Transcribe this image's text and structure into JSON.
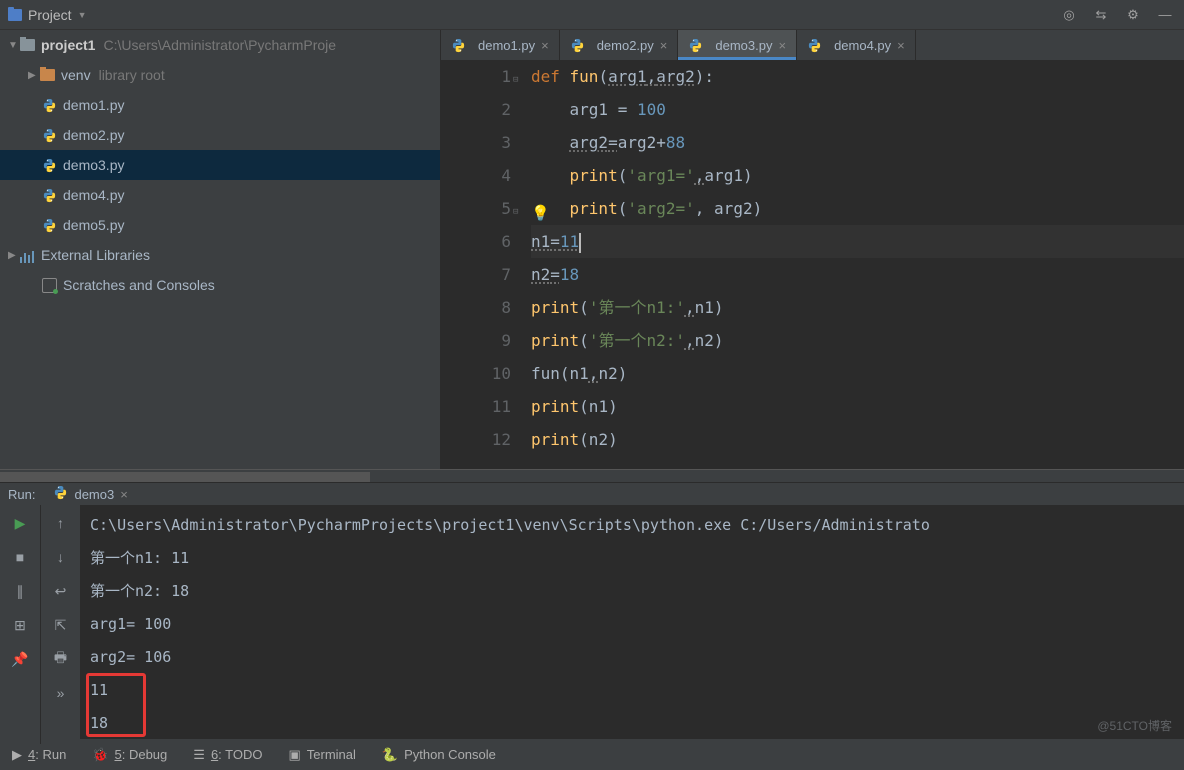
{
  "toolbar": {
    "project_label": "Project"
  },
  "tree": {
    "root_name": "project1",
    "root_path": "C:\\Users\\Administrator\\PycharmProje",
    "venv": "venv",
    "venv_note": "library root",
    "files": [
      "demo1.py",
      "demo2.py",
      "demo3.py",
      "demo4.py",
      "demo5.py"
    ],
    "ext_lib": "External Libraries",
    "scratches": "Scratches and Consoles"
  },
  "tabs": [
    {
      "label": "demo1.py"
    },
    {
      "label": "demo2.py"
    },
    {
      "label": "demo3.py"
    },
    {
      "label": "demo4.py"
    }
  ],
  "active_tab": 2,
  "selected_file": 2,
  "code": {
    "lines": [
      {
        "n": 1,
        "seg": [
          {
            "t": "def ",
            "c": "kw"
          },
          {
            "t": "fun",
            "c": "fn"
          },
          {
            "t": "(",
            "c": ""
          },
          {
            "t": "arg1",
            "c": "par und"
          },
          {
            "t": ",",
            "c": "und"
          },
          {
            "t": "arg2",
            "c": "par und"
          },
          {
            "t": ")",
            "c": ""
          },
          {
            "t": ":",
            "c": ""
          }
        ],
        "ind": 0
      },
      {
        "n": 2,
        "seg": [
          {
            "t": "arg1 = ",
            "c": ""
          },
          {
            "t": "100",
            "c": "num"
          }
        ],
        "ind": 1
      },
      {
        "n": 3,
        "seg": [
          {
            "t": "arg2",
            "c": "und"
          },
          {
            "t": "=",
            "c": "und"
          },
          {
            "t": "arg2+",
            "c": ""
          },
          {
            "t": "88",
            "c": "num"
          }
        ],
        "ind": 1
      },
      {
        "n": 4,
        "seg": [
          {
            "t": "print",
            "c": "fn"
          },
          {
            "t": "(",
            "c": ""
          },
          {
            "t": "'arg1='",
            "c": "str"
          },
          {
            "t": ",",
            "c": "und"
          },
          {
            "t": "arg1)",
            "c": ""
          }
        ],
        "ind": 1
      },
      {
        "n": 5,
        "seg": [
          {
            "t": "print",
            "c": "fn"
          },
          {
            "t": "(",
            "c": ""
          },
          {
            "t": "'arg2='",
            "c": "str"
          },
          {
            "t": ", arg2)",
            "c": ""
          }
        ],
        "ind": 1
      },
      {
        "n": 6,
        "seg": [
          {
            "t": "n1",
            "c": "und"
          },
          {
            "t": "=",
            "c": "und"
          },
          {
            "t": "11",
            "c": "num und"
          }
        ],
        "ind": 0,
        "hl": true,
        "cursor": true
      },
      {
        "n": 7,
        "seg": [
          {
            "t": "n2",
            "c": "und"
          },
          {
            "t": "=",
            "c": "und"
          },
          {
            "t": "18",
            "c": "num"
          }
        ],
        "ind": 0
      },
      {
        "n": 8,
        "seg": [
          {
            "t": "print",
            "c": "fn"
          },
          {
            "t": "(",
            "c": ""
          },
          {
            "t": "'第一个n1:'",
            "c": "str"
          },
          {
            "t": ",",
            "c": "und"
          },
          {
            "t": "n1)",
            "c": ""
          }
        ],
        "ind": 0
      },
      {
        "n": 9,
        "seg": [
          {
            "t": "print",
            "c": "fn"
          },
          {
            "t": "(",
            "c": ""
          },
          {
            "t": "'第一个n2:'",
            "c": "str"
          },
          {
            "t": ",",
            "c": "und"
          },
          {
            "t": "n2)",
            "c": ""
          }
        ],
        "ind": 0
      },
      {
        "n": 10,
        "seg": [
          {
            "t": "fun(n1",
            "c": ""
          },
          {
            "t": ",",
            "c": "und"
          },
          {
            "t": "n2)",
            "c": ""
          }
        ],
        "ind": 0
      },
      {
        "n": 11,
        "seg": [
          {
            "t": "print",
            "c": "fn"
          },
          {
            "t": "(n1)",
            "c": ""
          }
        ],
        "ind": 0
      },
      {
        "n": 12,
        "seg": [
          {
            "t": "print",
            "c": "fn"
          },
          {
            "t": "(n2)",
            "c": ""
          }
        ],
        "ind": 0
      }
    ]
  },
  "run": {
    "label": "Run:",
    "config": "demo3",
    "output": [
      "C:\\Users\\Administrator\\PycharmProjects\\project1\\venv\\Scripts\\python.exe C:/Users/Administrato",
      "第一个n1: 11",
      "第一个n2: 18",
      "arg1= 100",
      "arg2= 106",
      "11",
      "18"
    ]
  },
  "statusbar": {
    "run": "4: Run",
    "debug": "5: Debug",
    "todo": "6: TODO",
    "terminal": "Terminal",
    "console": "Python Console"
  },
  "watermark": "@51CTO博客"
}
